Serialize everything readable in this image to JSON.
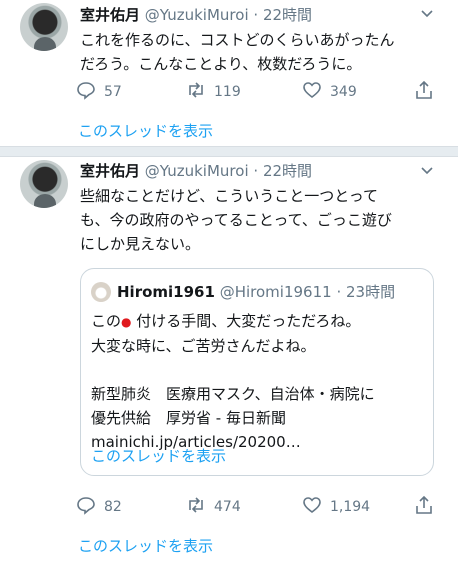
{
  "tweet1": {
    "name": "室井佑月",
    "handle": "@YuzukiMuroi",
    "dot": "·",
    "time": "22時間",
    "lines": [
      "これを作るのに、コストどのくらいあがったん",
      "だろう。こんなことより、枚数だろうに。"
    ],
    "replies": "57",
    "retweets": "119",
    "likes": "349",
    "thread_link": "このスレッドを表示"
  },
  "tweet2": {
    "name": "室井佑月",
    "handle": "@YuzukiMuroi",
    "dot": "·",
    "time": "22時間",
    "lines": [
      "些細なことだけど、こういうこと一つとって",
      "も、今の政府のやってることって、ごっこ遊び",
      "にしか見えない。"
    ],
    "quote": {
      "name": "Hiromi1961",
      "handle": "@Hiromi19611",
      "dot": "·",
      "time": "23時間",
      "line1_pre": "この",
      "line1_icon": "●",
      "line1_post": " 付ける手間、大変だっただろね。",
      "line2": "大変な時に、ご苦労さんだよね。",
      "line3": "新型肺炎　医療用マスク、自治体・病院に",
      "line4": "優先供給　厚労省 - 毎日新聞",
      "line5": "mainichi.jp/articles/20200…",
      "thread_link": "このスレッドを表示"
    },
    "replies": "82",
    "retweets": "474",
    "likes": "1,194",
    "thread_link": "このスレッドを表示"
  },
  "colors": {
    "accent": "#1da1f2",
    "muted": "#657786",
    "red": "#e0191e",
    "divider": "#e6ecf0"
  },
  "icons": [
    "reply-icon",
    "retweet-icon",
    "like-icon",
    "share-icon",
    "chevron-down-icon"
  ]
}
